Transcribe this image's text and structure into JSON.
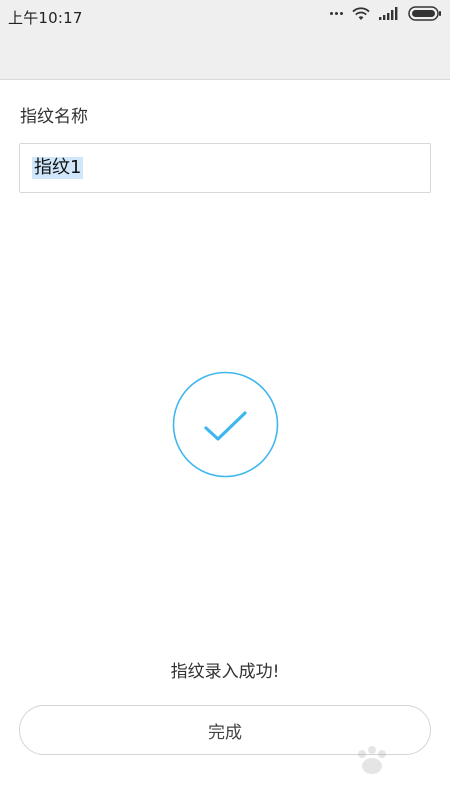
{
  "status_bar": {
    "time": "上午10:17",
    "icons": [
      "more-dots-icon",
      "wifi-icon",
      "signal-icon",
      "battery-icon"
    ]
  },
  "form": {
    "label": "指纹名称",
    "name_value": "指纹1"
  },
  "result": {
    "icon": "check-circle-icon",
    "message": "指纹录入成功!"
  },
  "actions": {
    "done_label": "完成"
  },
  "colors": {
    "accent": "#3fb6ee",
    "header_bg": "#efefef",
    "selection": "#cfe6fb"
  }
}
